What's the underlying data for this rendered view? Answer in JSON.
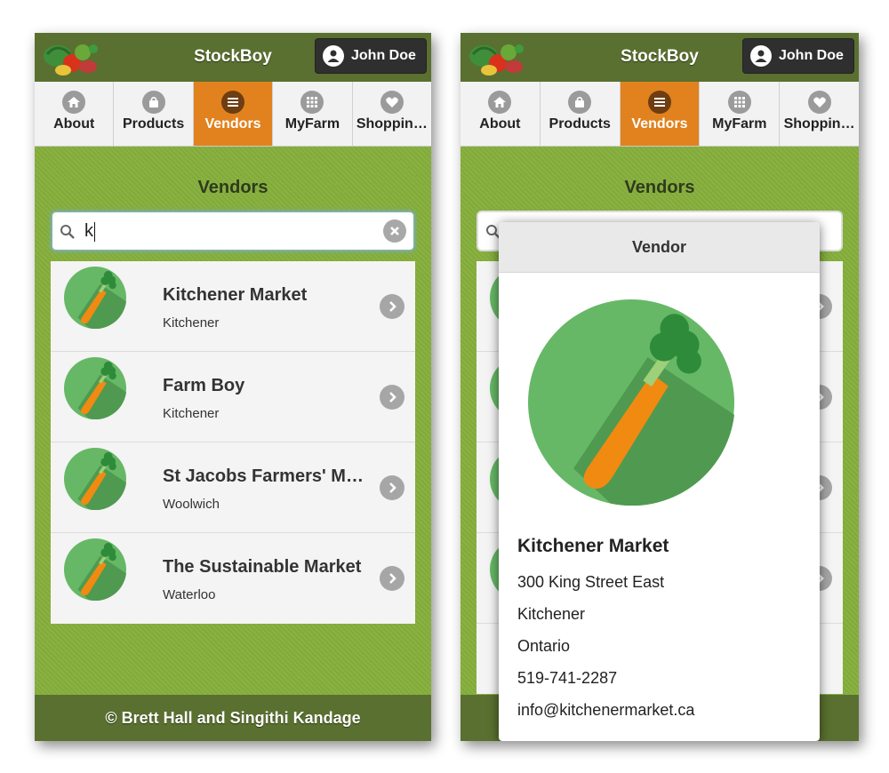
{
  "app": {
    "title": "StockBoy",
    "user_name": "John Doe",
    "footer": "© Brett Hall and Singithi Kandage"
  },
  "nav": [
    {
      "label": "About",
      "icon": "home-icon",
      "active": false
    },
    {
      "label": "Products",
      "icon": "bag-icon",
      "active": false
    },
    {
      "label": "Vendors",
      "icon": "list-icon",
      "active": true
    },
    {
      "label": "MyFarm",
      "icon": "grid-icon",
      "active": false
    },
    {
      "label": "Shoppin…",
      "icon": "heart-icon",
      "active": false
    }
  ],
  "page": {
    "heading": "Vendors"
  },
  "search": {
    "value": "k"
  },
  "vendors": [
    {
      "name": "Kitchener Market",
      "city": "Kitchener"
    },
    {
      "name": "Farm Boy",
      "city": "Kitchener"
    },
    {
      "name": "St Jacobs Farmers' M…",
      "city": "Woolwich"
    },
    {
      "name": "The Sustainable Market",
      "city": "Waterloo"
    }
  ],
  "popup": {
    "title": "Vendor",
    "name": "Kitchener Market",
    "address": "300 King Street East",
    "city": "Kitchener",
    "province": "Ontario",
    "phone": "519-741-2287",
    "email": "info@kitchenermarket.ca"
  },
  "colors": {
    "header": "#5a7030",
    "page_bg": "#86b03c",
    "active_tab": "#e1821f",
    "carrot": "#f08a10",
    "circle": "#66b866"
  }
}
